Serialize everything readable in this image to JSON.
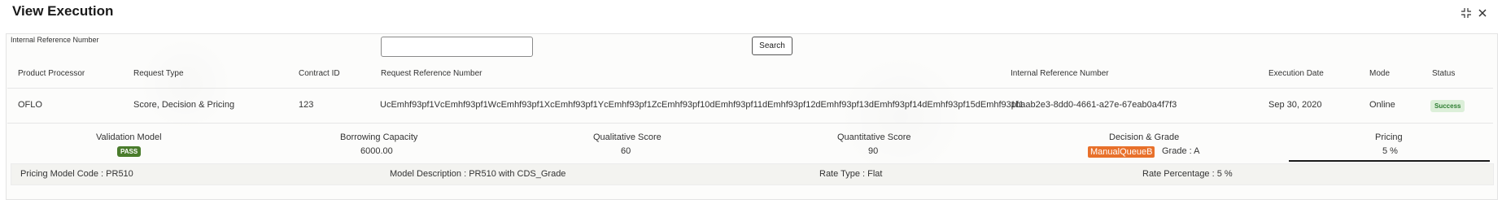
{
  "window": {
    "title": "View Execution",
    "controls": {
      "restore_icon": "collapse-icon",
      "close_icon": "close-icon"
    }
  },
  "search": {
    "label": "Internal Reference Number",
    "input_value": "",
    "button_label": "Search"
  },
  "table": {
    "headers": {
      "product_processor": "Product Processor",
      "request_type": "Request Type",
      "contract_id": "Contract ID",
      "request_reference_number": "Request Reference Number",
      "internal_reference_number": "Internal Reference Number",
      "execution_date": "Execution Date",
      "mode": "Mode",
      "status": "Status"
    },
    "rows": [
      {
        "product_processor": "OFLO",
        "request_type": "Score, Decision & Pricing",
        "contract_id": "123",
        "request_reference_number": "UcEmhf93pf1VcEmhf93pf1WcEmhf93pf1XcEmhf93pf1YcEmhf93pf1ZcEmhf93pf10dEmhf93pf11dEmhf93pf12dEmhf93pf13dEmhf93pf14dEmhf93pf15dEmhf93pf1",
        "internal_reference_number": "1baab2e3-8dd0-4661-a27e-67eab0a4f7f3",
        "execution_date": "Sep 30, 2020",
        "mode": "Online",
        "status": "Success"
      }
    ]
  },
  "summary": {
    "validation_model": {
      "label": "Validation Model",
      "value": "PASS"
    },
    "borrowing_capacity": {
      "label": "Borrowing Capacity",
      "value": "6000.00"
    },
    "qualitative_score": {
      "label": "Qualitative Score",
      "value": "60"
    },
    "quantitative_score": {
      "label": "Quantitative Score",
      "value": "90"
    },
    "decision_grade": {
      "label": "Decision & Grade",
      "decision": "ManualQueueB",
      "grade": "Grade : A"
    },
    "pricing": {
      "label": "Pricing",
      "value": "5 %"
    }
  },
  "pricing_details": {
    "model_code": "Pricing Model Code : PR510",
    "model_description": "Model Description : PR510 with CDS_Grade",
    "rate_type": "Rate Type : Flat",
    "rate_percentage": "Rate Percentage : 5 %"
  },
  "colors": {
    "pass_badge": "#4a7c2c",
    "success_badge_bg": "#dcefd9",
    "success_badge_text": "#2e7d32",
    "manual_queue_badge": "#e8702a"
  }
}
